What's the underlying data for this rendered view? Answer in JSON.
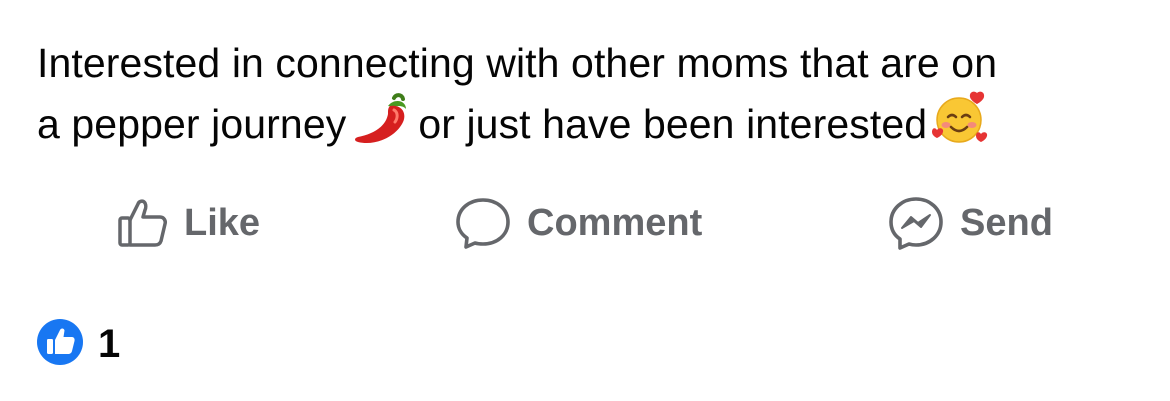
{
  "post": {
    "text_line_1": "Interested in connecting with other moms that are on",
    "text_line_2_part_1": "a pepper journey",
    "text_line_2_part_2": "or just have been interested",
    "emojis": [
      "hot-pepper-emoji",
      "smiling-face-with-hearts-emoji"
    ]
  },
  "actions": {
    "like_label": "Like",
    "comment_label": "Comment",
    "send_label": "Send"
  },
  "reactions": {
    "count": "1",
    "icon": "like-reaction-icon"
  },
  "colors": {
    "text": "#050505",
    "action_gray": "#65676b",
    "like_blue": "#1877f2"
  }
}
